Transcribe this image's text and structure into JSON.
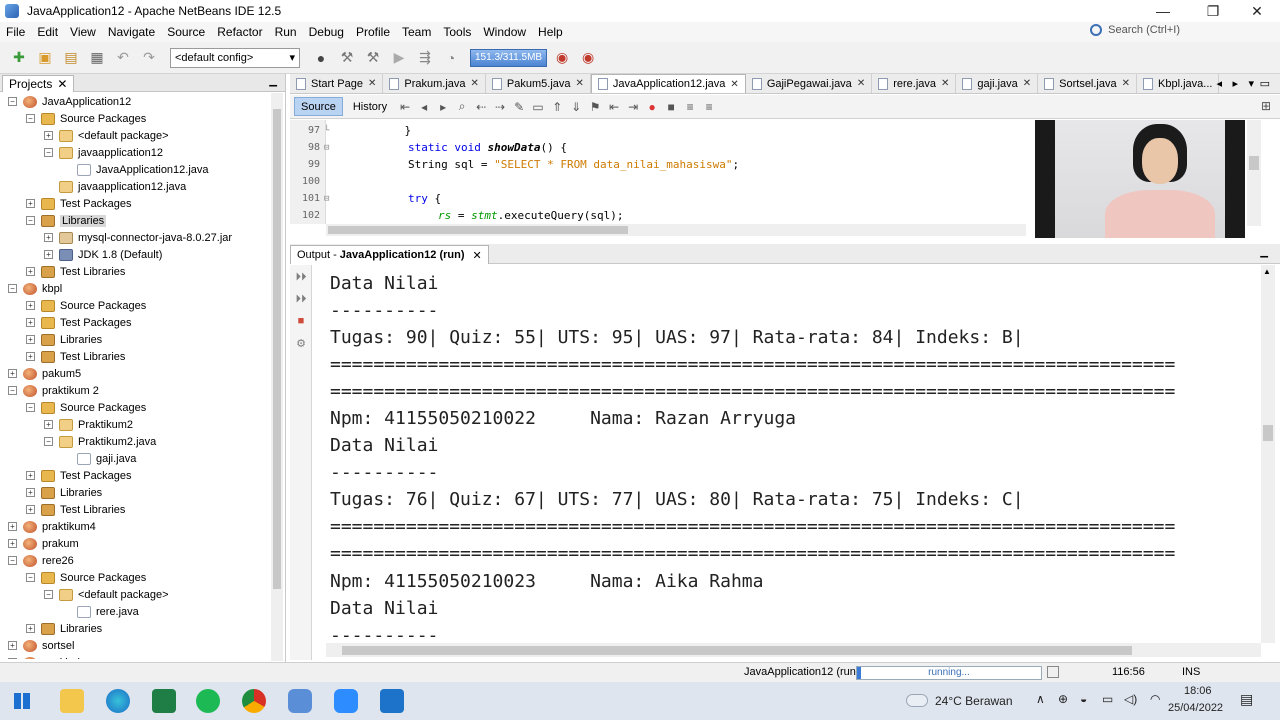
{
  "window": {
    "title": "JavaApplication12 - Apache NetBeans IDE 12.5",
    "controls": [
      "—",
      "❐",
      "✕"
    ]
  },
  "menu": [
    "File",
    "Edit",
    "View",
    "Navigate",
    "Source",
    "Refactor",
    "Run",
    "Debug",
    "Profile",
    "Team",
    "Tools",
    "Window",
    "Help"
  ],
  "search": {
    "placeholder": "Search (Ctrl+I)"
  },
  "toolbar": {
    "config": "<default config>",
    "memory": "151.3/311.5MB"
  },
  "projects_panel": {
    "tab_label": "Projects",
    "tree": [
      {
        "indent": 0,
        "exp": "⊟",
        "icon": "proj",
        "label": "JavaApplication12"
      },
      {
        "indent": 1,
        "exp": "⊟",
        "icon": "pkgs",
        "label": "Source Packages"
      },
      {
        "indent": 2,
        "exp": "⊞",
        "icon": "pkg",
        "label": "<default package>"
      },
      {
        "indent": 2,
        "exp": "⊟",
        "icon": "pkg",
        "label": "javaapplication12"
      },
      {
        "indent": 3,
        "exp": "",
        "icon": "jfile",
        "label": "JavaApplication12.java"
      },
      {
        "indent": 2,
        "exp": "",
        "icon": "pkg",
        "label": "javaapplication12.java"
      },
      {
        "indent": 1,
        "exp": "⊞",
        "icon": "pkgs",
        "label": "Test Packages"
      },
      {
        "indent": 1,
        "exp": "⊟",
        "icon": "libs",
        "label": "Libraries",
        "selected": true
      },
      {
        "indent": 2,
        "exp": "⊞",
        "icon": "jar",
        "label": "mysql-connector-java-8.0.27.jar"
      },
      {
        "indent": 2,
        "exp": "⊞",
        "icon": "jdk",
        "label": "JDK 1.8 (Default)"
      },
      {
        "indent": 1,
        "exp": "⊞",
        "icon": "libs",
        "label": "Test Libraries"
      },
      {
        "indent": 0,
        "exp": "⊟",
        "icon": "proj",
        "label": "kbpl"
      },
      {
        "indent": 1,
        "exp": "⊞",
        "icon": "pkgs",
        "label": "Source Packages"
      },
      {
        "indent": 1,
        "exp": "⊞",
        "icon": "pkgs",
        "label": "Test Packages"
      },
      {
        "indent": 1,
        "exp": "⊞",
        "icon": "libs",
        "label": "Libraries"
      },
      {
        "indent": 1,
        "exp": "⊞",
        "icon": "libs",
        "label": "Test Libraries"
      },
      {
        "indent": 0,
        "exp": "⊞",
        "icon": "proj",
        "label": "pakum5"
      },
      {
        "indent": 0,
        "exp": "⊟",
        "icon": "proj",
        "label": "praktikum 2"
      },
      {
        "indent": 1,
        "exp": "⊟",
        "icon": "pkgs",
        "label": "Source Packages"
      },
      {
        "indent": 2,
        "exp": "⊞",
        "icon": "pkg",
        "label": "Praktikum2"
      },
      {
        "indent": 2,
        "exp": "⊟",
        "icon": "pkg",
        "label": "Praktikum2.java"
      },
      {
        "indent": 3,
        "exp": "",
        "icon": "jfile",
        "label": "gaji.java"
      },
      {
        "indent": 1,
        "exp": "⊞",
        "icon": "pkgs",
        "label": "Test Packages"
      },
      {
        "indent": 1,
        "exp": "⊞",
        "icon": "libs",
        "label": "Libraries"
      },
      {
        "indent": 1,
        "exp": "⊞",
        "icon": "libs",
        "label": "Test Libraries"
      },
      {
        "indent": 0,
        "exp": "⊞",
        "icon": "proj",
        "label": "praktikum4"
      },
      {
        "indent": 0,
        "exp": "⊞",
        "icon": "proj",
        "label": "prakum"
      },
      {
        "indent": 0,
        "exp": "⊟",
        "icon": "proj",
        "label": "rere26"
      },
      {
        "indent": 1,
        "exp": "⊟",
        "icon": "pkgs",
        "label": "Source Packages"
      },
      {
        "indent": 2,
        "exp": "⊟",
        "icon": "pkg",
        "label": "<default package>"
      },
      {
        "indent": 3,
        "exp": "",
        "icon": "jfile",
        "label": "rere.java"
      },
      {
        "indent": 1,
        "exp": "⊞",
        "icon": "libs",
        "label": "Libraries"
      },
      {
        "indent": 0,
        "exp": "⊞",
        "icon": "proj",
        "label": "sortsel"
      },
      {
        "indent": 0,
        "exp": "⊞",
        "icon": "proj",
        "label": "uaskbpl"
      }
    ]
  },
  "editor_tabs": [
    {
      "label": "Start Page",
      "active": false
    },
    {
      "label": "Prakum.java",
      "active": false
    },
    {
      "label": "Pakum5.java",
      "active": false
    },
    {
      "label": "JavaApplication12.java",
      "active": true
    },
    {
      "label": "GajiPegawai.java",
      "active": false
    },
    {
      "label": "rere.java",
      "active": false
    },
    {
      "label": "gaji.java",
      "active": false
    },
    {
      "label": "Sortsel.java",
      "active": false
    },
    {
      "label": "Kbpl.java...",
      "active": false
    }
  ],
  "editor_toolbar": {
    "source": "Source",
    "history": "History"
  },
  "code": {
    "lines": [
      {
        "n": "97",
        "text": "    }"
      },
      {
        "n": "98",
        "kw1": "static void ",
        "fn": "showData",
        "rest": "() {"
      },
      {
        "n": "99",
        "pre": "String sql = ",
        "str": "\"SELECT * FROM data_nilai_mahasiswa\"",
        "post": ";"
      },
      {
        "n": "100",
        "text": ""
      },
      {
        "n": "101",
        "kw": "try",
        "post": " {"
      },
      {
        "n": "102",
        "it1": "rs",
        "mid": " = ",
        "it2": "stmt",
        "post": ".executeQuery(sql);"
      }
    ]
  },
  "output": {
    "tab_label": "Output - ",
    "tab_bold": "JavaApplication12 (run)",
    "lines": [
      "Data Nilai",
      "----------",
      "Tugas: 90| Quiz: 55| UTS: 95| UAS: 97| Rata-rata: 84| Indeks: B|",
      "==============================================================================",
      "==============================================================================",
      "Npm: 41155050210022     Nama: Razan Arryuga",
      "Data Nilai",
      "----------",
      "Tugas: 76| Quiz: 67| UTS: 77| UAS: 80| Rata-rata: 75| Indeks: C|",
      "==============================================================================",
      "==============================================================================",
      "Npm: 41155050210023     Nama: Aika Rahma",
      "Data Nilai",
      "----------"
    ]
  },
  "statusbar": {
    "run_label": "JavaApplication12 (run)",
    "progress_text": "running...",
    "position": "116:56",
    "mode": "INS"
  },
  "taskbar": {
    "weather": "24°C  Berawan",
    "time": "18:06",
    "date": "25/04/2022"
  }
}
